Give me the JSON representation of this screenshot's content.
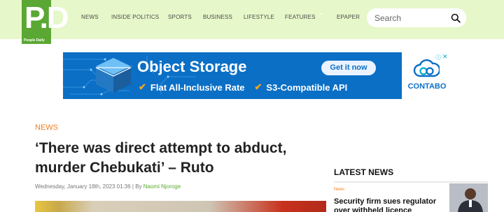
{
  "header": {
    "logo_glyph": "P.D",
    "logo_text": "People Daily",
    "nav": [
      "NEWS",
      "INSIDE POLITICS",
      "SPORTS",
      "BUSINESS",
      "LIFESTYLE",
      "FEATURES",
      "EPAPER"
    ],
    "search_placeholder": "Search"
  },
  "ad": {
    "title": "Object Storage",
    "features": [
      "Flat All-Inclusive Rate",
      "S3-Compatible API"
    ],
    "cta": "Get it now",
    "brand": "CONTABO",
    "colors": {
      "background": "#0b6fc6",
      "check": "#f6a623"
    }
  },
  "article": {
    "category": "NEWS",
    "headline": "‘There was direct attempt to abduct, murder Chebukati’ – Ruto",
    "date": "Wednesday, January 18th, 2023 01:36 | By ",
    "author": "Naomi Njoroge"
  },
  "sidebar": {
    "heading": "LATEST NEWS",
    "items": [
      {
        "category": "News",
        "title": "Security firm sues regulator over withheld licence"
      }
    ]
  },
  "colors": {
    "header_bg": "#e6f7c9",
    "brand_green": "#5aa833",
    "accent_orange": "#f07f1d"
  }
}
